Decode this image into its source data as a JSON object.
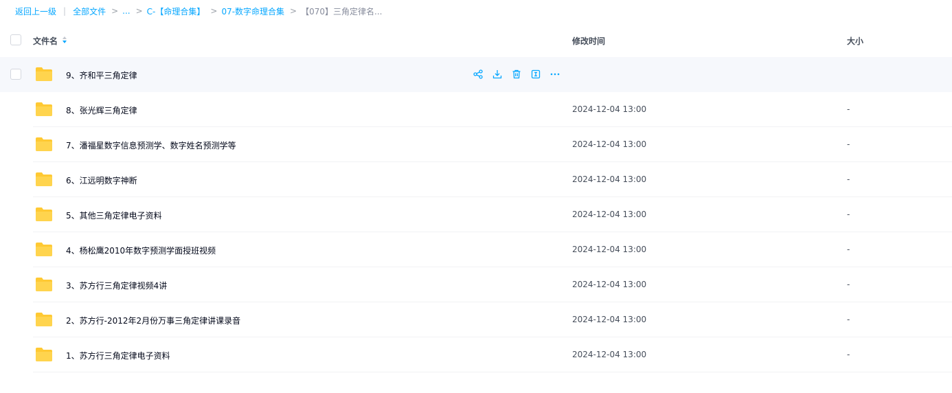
{
  "breadcrumb": {
    "back": "返回上一级",
    "divider": "|",
    "all_files": "全部文件",
    "sep": ">",
    "ellipsis": "...",
    "level1": "C-【命理合集】",
    "level2": "07-数字命理合集",
    "current": "【070】三角定律名..."
  },
  "table": {
    "col_name": "文件名",
    "col_time": "修改时间",
    "col_size": "大小",
    "rows": [
      {
        "name": "9、齐和平三角定律",
        "time": "",
        "size": ""
      },
      {
        "name": "8、张光辉三角定律",
        "time": "2024-12-04 13:00",
        "size": "-"
      },
      {
        "name": "7、潘福星数字信息预测学、数字姓名预测学等",
        "time": "2024-12-04 13:00",
        "size": "-"
      },
      {
        "name": "6、江远明数字神断",
        "time": "2024-12-04 13:00",
        "size": "-"
      },
      {
        "name": "5、其他三角定律电子资料",
        "time": "2024-12-04 13:00",
        "size": "-"
      },
      {
        "name": "4、杨松鹰2010年数字预测学面授班视频",
        "time": "2024-12-04 13:00",
        "size": "-"
      },
      {
        "name": "3、苏方行三角定律视频4讲",
        "time": "2024-12-04 13:00",
        "size": "-"
      },
      {
        "name": "2、苏方行-2012年2月份万事三角定律讲课录音",
        "time": "2024-12-04 13:00",
        "size": "-"
      },
      {
        "name": "1、苏方行三角定律电子资料",
        "time": "2024-12-04 13:00",
        "size": "-"
      }
    ]
  },
  "row_actions": [
    "share-icon",
    "download-icon",
    "delete-icon",
    "rename-icon",
    "more-icon"
  ],
  "colors": {
    "accent": "#06a7ff",
    "folder": "#ffc933",
    "hover_bg": "#f6f8fc"
  }
}
